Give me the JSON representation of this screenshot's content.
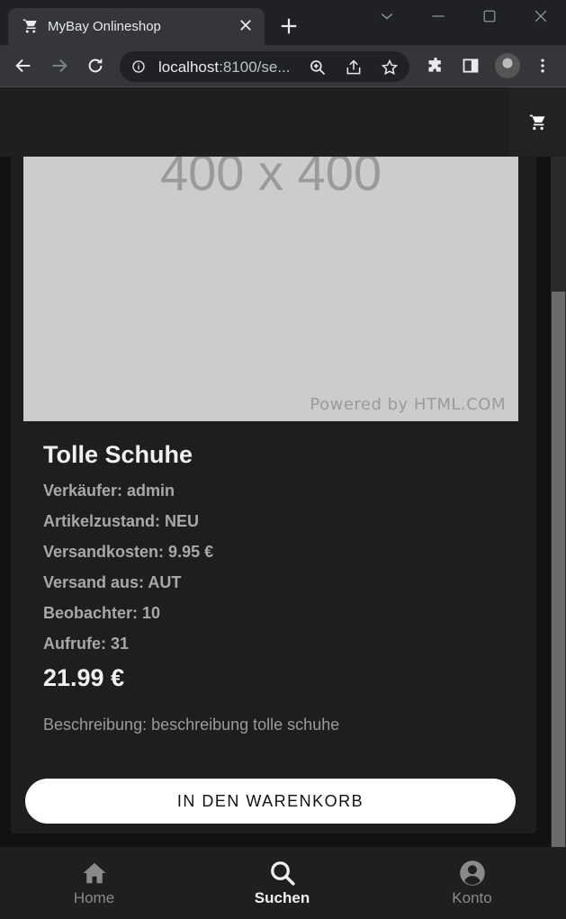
{
  "browser": {
    "tab_title": "MyBay Onlineshop",
    "url_host": "localhost",
    "url_rest": ":8100/se..."
  },
  "product": {
    "image_placeholder": "400 x 400",
    "image_credit": "Powered by HTML.COM",
    "title": "Tolle Schuhe",
    "seller": "Verkäufer: admin",
    "condition": "Artikelzustand: NEU",
    "shipping_cost": "Versandkosten: 9.95 €",
    "ships_from": "Versand aus: AUT",
    "watchers": "Beobachter: 10",
    "views": "Aufrufe: 31",
    "price": "21.99 €",
    "description": "Beschreibung: beschreibung tolle schuhe",
    "add_to_cart_label": "IN DEN WARENKORB"
  },
  "tabs": [
    {
      "label": "Home",
      "icon": "home-icon",
      "active": false
    },
    {
      "label": "Suchen",
      "icon": "search-icon",
      "active": true
    },
    {
      "label": "Konto",
      "icon": "account-icon",
      "active": false
    }
  ],
  "colors": {
    "background": "#121212",
    "card": "#1e1e1e",
    "button": "#ffffff",
    "active_tab": "#f0f0f0"
  }
}
